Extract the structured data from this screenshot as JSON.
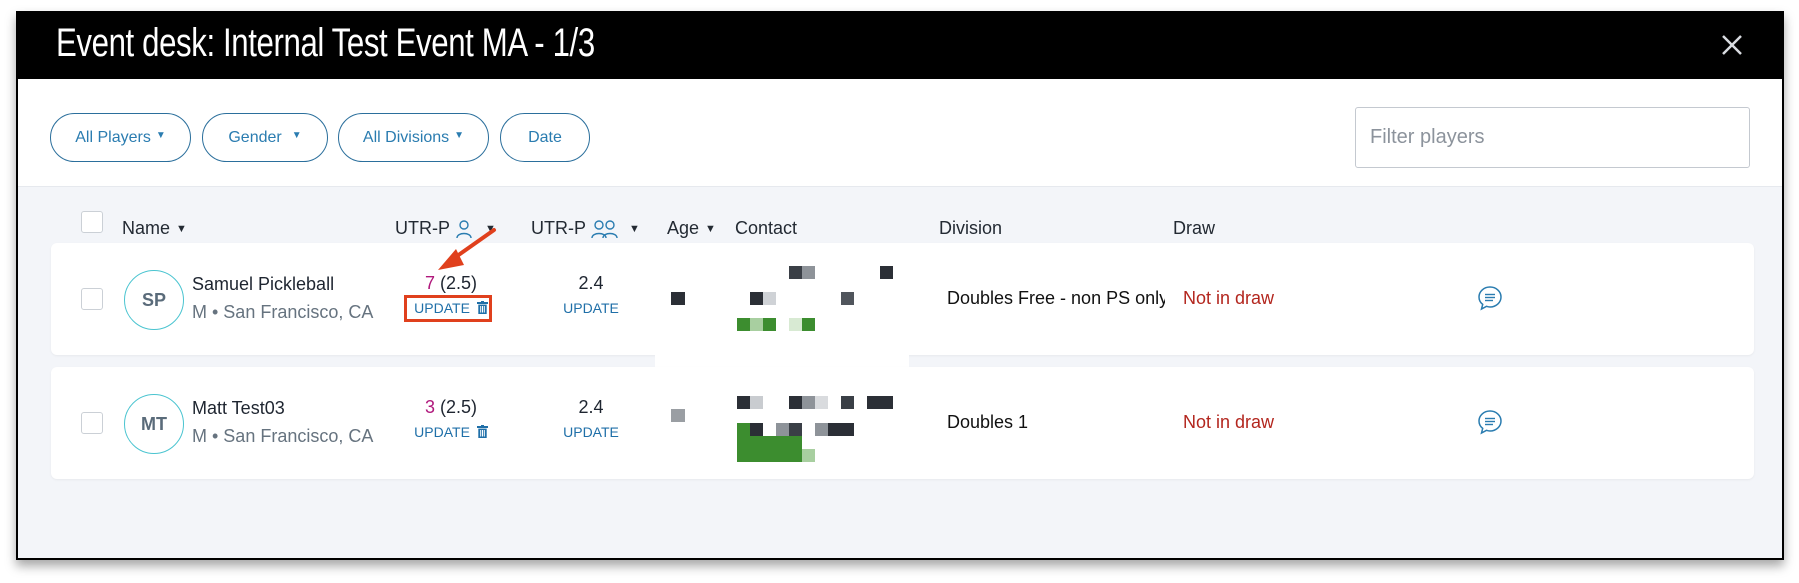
{
  "window": {
    "title": "Event desk: Internal Test Event MA - 1/3"
  },
  "filters": {
    "players": "All Players",
    "gender": "Gender",
    "divisions": "All Divisions",
    "date": "Date",
    "search_placeholder": "Filter players",
    "search_value": ""
  },
  "table": {
    "headers": {
      "name": "Name",
      "utr_singles": "UTR-P",
      "utr_doubles": "UTR-P",
      "age": "Age",
      "contact": "Contact",
      "division": "Division",
      "draw": "Draw"
    },
    "rows": [
      {
        "initials": "SP",
        "name": "Samuel Pickleball",
        "location": "M • San Francisco, CA",
        "utr_singles_value": "7",
        "utr_singles_rating": "(2.5)",
        "utr_singles_action": "UPDATE",
        "utr_doubles_value": "2.4",
        "utr_doubles_action": "UPDATE",
        "division": "Doubles Free - non PS only pilot",
        "draw": "Not in draw"
      },
      {
        "initials": "MT",
        "name": "Matt Test03",
        "location": "M • San Francisco, CA",
        "utr_singles_value": "3",
        "utr_singles_rating": "(2.5)",
        "utr_singles_action": "UPDATE",
        "utr_doubles_value": "2.4",
        "utr_doubles_action": "UPDATE",
        "division": "Doubles 1",
        "draw": "Not in draw"
      }
    ]
  },
  "colors": {
    "accent": "#2a7cb0",
    "rating": "#b0187c",
    "not_in_draw": "#b3261e",
    "annotation": "#e0401d",
    "avatar_ring": "#4ac4d0"
  },
  "icons": [
    "close-icon",
    "caret-down-icon",
    "person-icon",
    "people-icon",
    "trash-icon",
    "chat-icon",
    "annotation-arrow"
  ]
}
